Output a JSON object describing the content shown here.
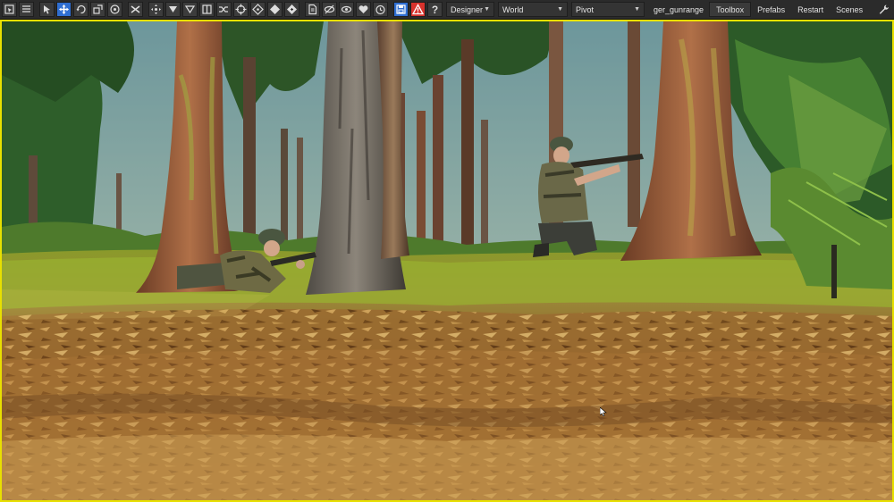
{
  "toolbar": {
    "buttons": [
      {
        "icon": "select-icon",
        "active": false
      },
      {
        "icon": "list-icon",
        "active": false
      },
      {
        "icon": "cursor-icon",
        "active": false
      },
      {
        "icon": "move-icon",
        "active": true
      },
      {
        "icon": "rotate-icon",
        "active": false
      },
      {
        "icon": "scale-icon",
        "active": false
      },
      {
        "icon": "snap-icon",
        "active": false
      },
      {
        "icon": "delete-icon",
        "active": false
      },
      {
        "icon": "transform-icon",
        "active": false
      },
      {
        "icon": "ground-snap-icon",
        "active": false
      },
      {
        "icon": "orient-icon",
        "active": false
      },
      {
        "icon": "split-icon",
        "active": false
      },
      {
        "icon": "random-icon",
        "active": false
      },
      {
        "icon": "center-icon",
        "active": false
      },
      {
        "icon": "align-icon",
        "active": false
      },
      {
        "icon": "diamond-icon",
        "active": false
      },
      {
        "icon": "diamond-alt-icon",
        "active": false
      },
      {
        "icon": "page-icon",
        "active": false
      },
      {
        "icon": "visibility-icon",
        "active": false
      },
      {
        "icon": "eye-icon",
        "active": false
      },
      {
        "icon": "heart-icon",
        "active": false
      },
      {
        "icon": "clock-icon",
        "active": false
      },
      {
        "icon": "save-icon",
        "active": true
      },
      {
        "icon": "warning-icon",
        "active": false
      },
      {
        "icon": "help-icon",
        "active": false
      }
    ],
    "mode_dropdown": "Designer",
    "space_dropdown": "World",
    "pivot_dropdown": "Pivot",
    "world_name": "ger_gunrange",
    "menu": [
      "Toolbox",
      "Prefabs",
      "Restart",
      "Scenes"
    ],
    "accent_color": "#2f6ed1",
    "warning_color": "#d8322c",
    "viewport_border_color": "#e8e000"
  },
  "viewport": {
    "scene": "forest with two soldiers aiming rifles"
  }
}
